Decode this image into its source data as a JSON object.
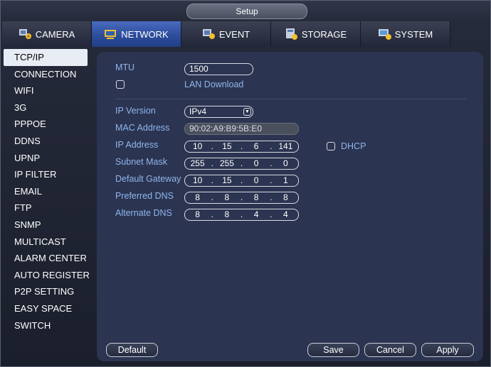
{
  "window": {
    "title": "Setup"
  },
  "tabs": [
    {
      "label": "CAMERA",
      "icon": "camera-settings-icon"
    },
    {
      "label": "NETWORK",
      "icon": "network-icon",
      "active": true
    },
    {
      "label": "EVENT",
      "icon": "event-icon"
    },
    {
      "label": "STORAGE",
      "icon": "storage-icon"
    },
    {
      "label": "SYSTEM",
      "icon": "system-icon"
    }
  ],
  "sidebar": {
    "items": [
      {
        "label": "TCP/IP",
        "active": true
      },
      {
        "label": "CONNECTION"
      },
      {
        "label": "WIFI"
      },
      {
        "label": "3G"
      },
      {
        "label": "PPPOE"
      },
      {
        "label": "DDNS"
      },
      {
        "label": "UPNP"
      },
      {
        "label": "IP FILTER"
      },
      {
        "label": "EMAIL"
      },
      {
        "label": "FTP"
      },
      {
        "label": "SNMP"
      },
      {
        "label": "MULTICAST"
      },
      {
        "label": "ALARM CENTER"
      },
      {
        "label": "AUTO REGISTER"
      },
      {
        "label": "P2P SETTING"
      },
      {
        "label": "EASY SPACE"
      },
      {
        "label": "SWITCH"
      }
    ]
  },
  "form": {
    "mtu": {
      "label": "MTU",
      "value": "1500"
    },
    "lan_download": {
      "label": "LAN Download",
      "checked": false
    },
    "ip_version": {
      "label": "IP Version",
      "value": "IPv4"
    },
    "mac_address": {
      "label": "MAC Address",
      "value": "90:02:A9:B9:5B:E0"
    },
    "ip_address": {
      "label": "IP Address",
      "octets": [
        "10",
        "15",
        "6",
        "141"
      ]
    },
    "dhcp": {
      "label": "DHCP",
      "checked": false
    },
    "subnet_mask": {
      "label": "Subnet Mask",
      "octets": [
        "255",
        "255",
        "0",
        "0"
      ]
    },
    "default_gateway": {
      "label": "Default Gateway",
      "octets": [
        "10",
        "15",
        "0",
        "1"
      ]
    },
    "preferred_dns": {
      "label": "Preferred DNS",
      "octets": [
        "8",
        "8",
        "8",
        "8"
      ]
    },
    "alternate_dns": {
      "label": "Alternate DNS",
      "octets": [
        "8",
        "8",
        "4",
        "4"
      ]
    }
  },
  "buttons": {
    "default": "Default",
    "save": "Save",
    "cancel": "Cancel",
    "apply": "Apply"
  },
  "colors": {
    "accent": "#2d4d9c",
    "label": "#8fb6ee",
    "panel": "#2b3450"
  }
}
